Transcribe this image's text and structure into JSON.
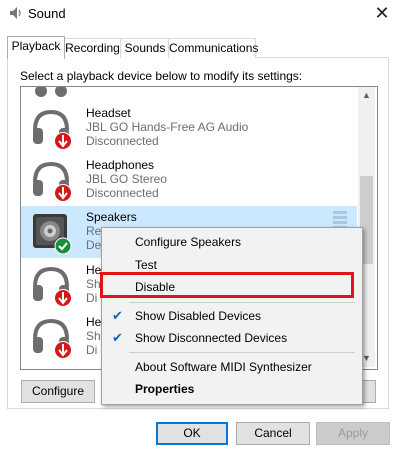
{
  "window": {
    "title": "Sound",
    "close_glyph": "✕"
  },
  "tabs": [
    {
      "label": "Playback",
      "active": true
    },
    {
      "label": "Recording",
      "active": false
    },
    {
      "label": "Sounds",
      "active": false
    },
    {
      "label": "Communications",
      "active": false
    }
  ],
  "instruction": "Select a playback device below to modify its settings:",
  "devices": [
    {
      "name": "Headset",
      "line1": "JBL GO Hands-Free AG Audio",
      "line2": "Disconnected",
      "icon": "headphones-icon",
      "status_icon": "disconnected-arrow-icon"
    },
    {
      "name": "Headphones",
      "line1": "JBL GO Stereo",
      "line2": "Disconnected",
      "icon": "headphones-icon",
      "status_icon": "disconnected-arrow-icon"
    },
    {
      "name": "Speakers",
      "line1": "Re",
      "line2": "De",
      "icon": "speaker-icon",
      "status_icon": "default-check-icon",
      "selected": true
    },
    {
      "name": "He",
      "line1": "Sh",
      "line2": "Di",
      "icon": "headphones-icon",
      "status_icon": "disconnected-arrow-icon"
    },
    {
      "name": "He",
      "line1": "Sh",
      "line2": "Di",
      "icon": "headphones-icon",
      "status_icon": "disconnected-arrow-icon"
    }
  ],
  "buttons": {
    "configure": "Configure",
    "ok": "OK",
    "cancel": "Cancel",
    "apply": "Apply"
  },
  "context_menu": {
    "items": [
      {
        "label": "Configure Speakers",
        "checked": false,
        "bold": false
      },
      {
        "label": "Test",
        "checked": false,
        "bold": false
      },
      {
        "label": "Disable",
        "checked": false,
        "bold": false,
        "highlighted": true
      },
      {
        "label": "Show Disabled Devices",
        "checked": true,
        "bold": false
      },
      {
        "label": "Show Disconnected Devices",
        "checked": true,
        "bold": false
      },
      {
        "label": "About Software MIDI Synthesizer",
        "checked": false,
        "bold": false
      },
      {
        "label": "Properties",
        "checked": false,
        "bold": true
      }
    ],
    "check_glyph": "✔"
  },
  "colors": {
    "selection": "#cce8ff",
    "highlight_border": "#e0131a",
    "default_button_border": "#0078d7",
    "check_color": "#0066cc"
  }
}
